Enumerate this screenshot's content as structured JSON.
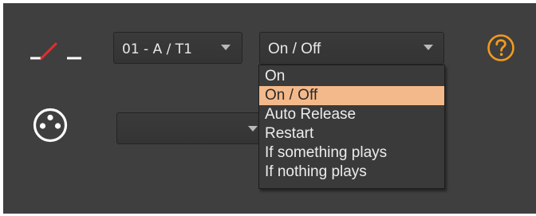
{
  "track_selector": {
    "value": "01 - A / T1"
  },
  "mode_selector": {
    "value": "On / Off",
    "options": [
      {
        "label": "On",
        "selected": false
      },
      {
        "label": "On / Off",
        "selected": true
      },
      {
        "label": "Auto Release",
        "selected": false
      },
      {
        "label": "Restart",
        "selected": false
      },
      {
        "label": "If something plays",
        "selected": false
      },
      {
        "label": "If nothing plays",
        "selected": false
      }
    ]
  },
  "secondary_selector": {
    "value": ""
  },
  "icons": {
    "switch": "switch-icon",
    "help": "help-icon",
    "xlr": "xlr-connector-icon"
  },
  "colors": {
    "panel_background": "#3f3f3f",
    "switch_accent": "#e0302e",
    "help_accent": "#f29a1f",
    "selection_highlight": "#f4b98a"
  }
}
